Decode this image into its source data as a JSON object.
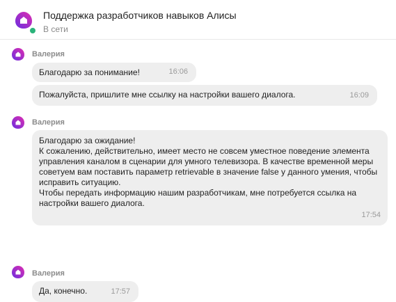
{
  "header": {
    "title": "Поддержка разработчиков навыков Алисы",
    "status": "В сети"
  },
  "colors": {
    "alice_purple": "#7a2bd9",
    "alice_pink": "#d92bb8",
    "online": "#2ab37a",
    "bubble": "#eeeeee"
  },
  "messages": [
    {
      "sender": "Валерия",
      "bubbles": [
        {
          "text": "Благодарю за понимание!",
          "time": "16:06"
        },
        {
          "text": "Пожалуйста, пришлите мне ссылку на настройки вашего диалога.",
          "time": "16:09"
        }
      ]
    },
    {
      "sender": "Валерия",
      "bubbles": [
        {
          "text": "Благодарю за ожидание!\nК сожалению, действительно, имеет место не совсем уместное поведение элемента управления каналом в сценарии для умного телевизора. В качестве временной меры советуем вам поставить параметр retrievable в значение false у данного умения, чтобы исправить ситуацию.\nЧтобы передать информацию нашим разработчикам, мне потребуется ссылка на настройки вашего диалога.",
          "time": "17:54"
        }
      ]
    },
    {
      "sender": "Валерия",
      "bubbles": [
        {
          "text": "Да, конечно.",
          "time": "17:57"
        }
      ]
    }
  ]
}
